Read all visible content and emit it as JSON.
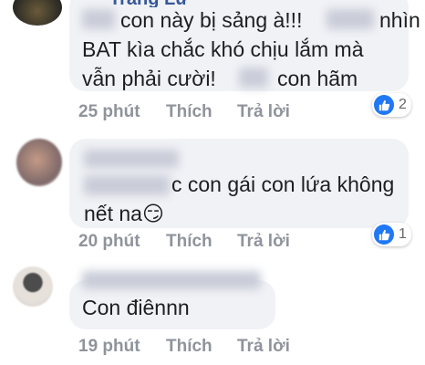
{
  "comments": [
    {
      "author": "Trang Lữ",
      "lines": [
        "con này bị sảng à!!!",
        "nhìn",
        "BAT kìa chắc khó chịu lắm mà",
        "vẫn phải cười!",
        "con hãm"
      ],
      "time": "25 phút",
      "like_label": "Thích",
      "reply_label": "Trả lời",
      "reactions": "2"
    },
    {
      "author": "",
      "lines": [
        "c con gái con lứa không",
        "nết na😏"
      ],
      "time": "20 phút",
      "like_label": "Thích",
      "reply_label": "Trả lời",
      "reactions": "1"
    },
    {
      "author": "",
      "lines": [
        "Con điênnn"
      ],
      "time": "19 phút",
      "like_label": "Thích",
      "reply_label": "Trả lời"
    }
  ],
  "colors": {
    "bubble": "#f1f2f6",
    "name": "#365899",
    "meta": "#8f939b",
    "like_badge": "#2078f4"
  },
  "icons": {
    "reaction": "thumbs-up-icon"
  }
}
